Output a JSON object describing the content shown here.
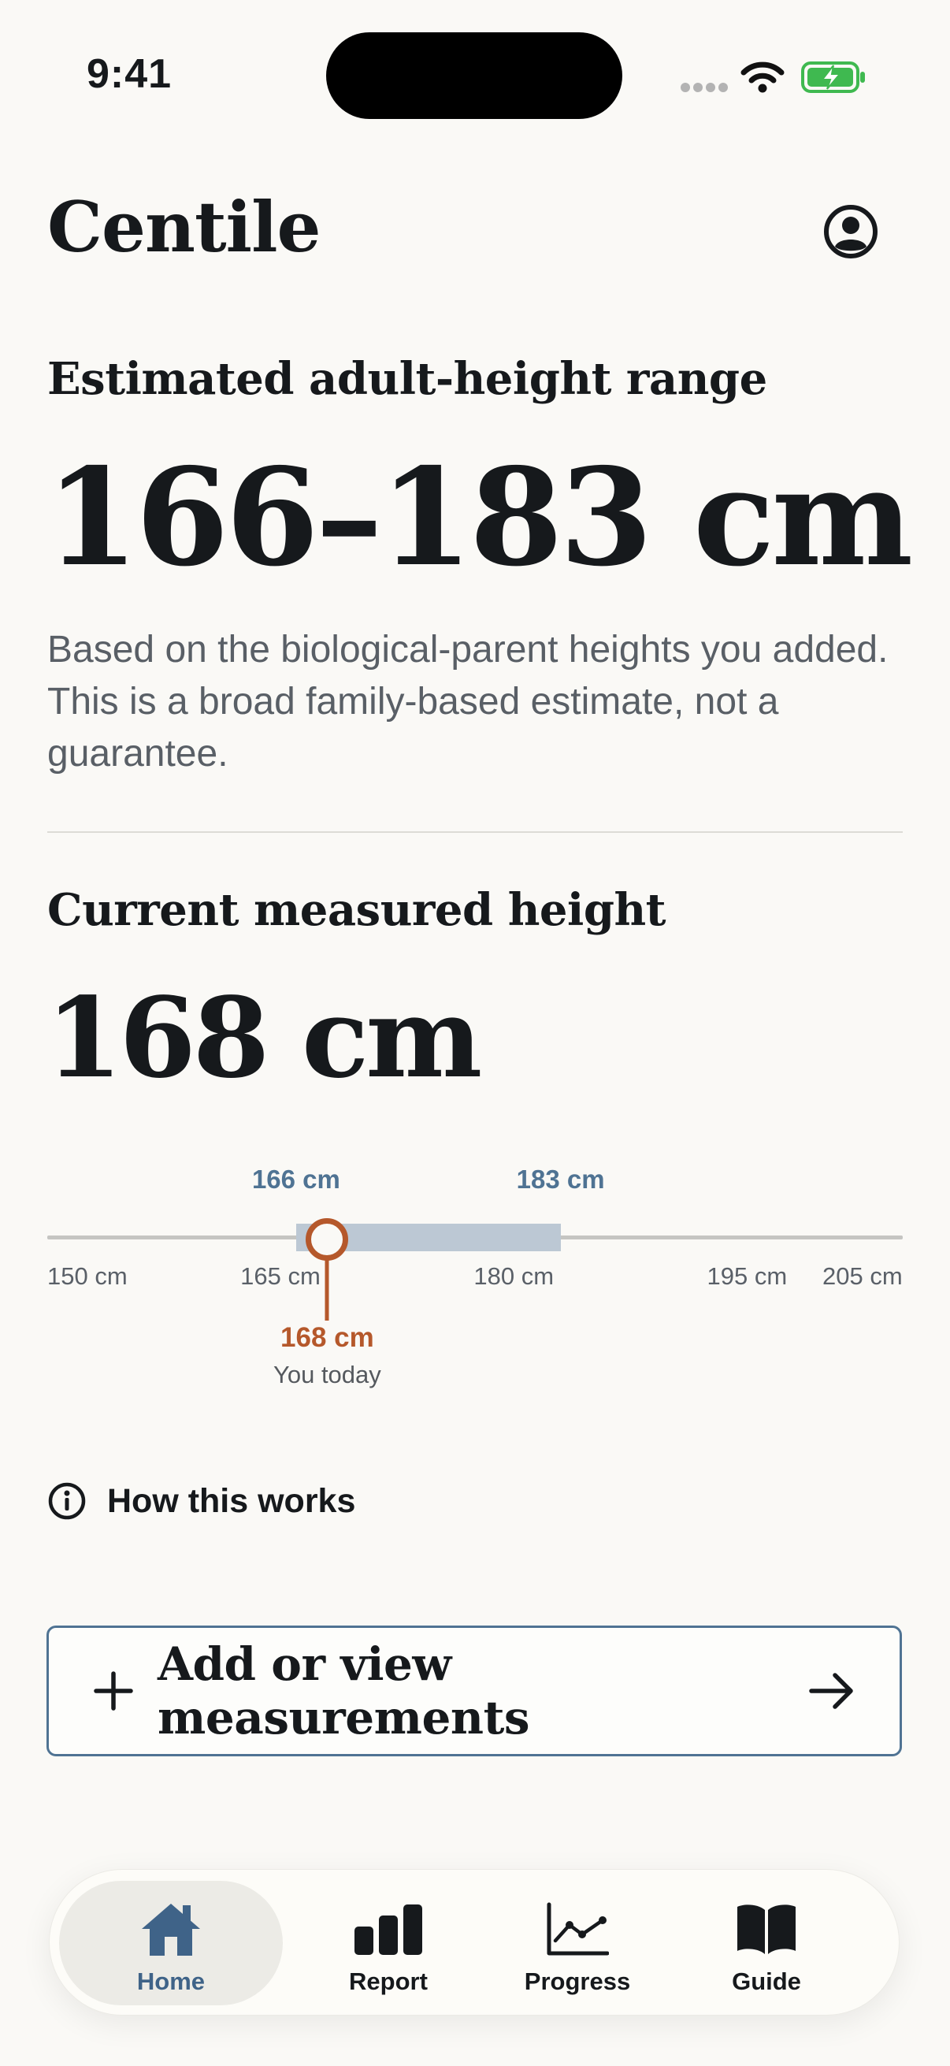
{
  "status_bar": {
    "time": "9:41"
  },
  "header": {
    "title": "Centile",
    "profile_icon": "person-circle-icon"
  },
  "range_section": {
    "heading": "Estimated adult-height range",
    "value": "166–183 cm",
    "description": "Based on the biological-parent heights you added. This is a broad family-based estimate, not a guarantee."
  },
  "current_section": {
    "heading": "Current measured height",
    "value": "168 cm"
  },
  "range_chart": {
    "scale_min_cm": 150,
    "scale_max_cm": 205,
    "range_low_cm": 166,
    "range_high_cm": 183,
    "current_cm": 168,
    "range_low_label": "166 cm",
    "range_high_label": "183 cm",
    "ticks": [
      {
        "value": 150,
        "label": "150 cm"
      },
      {
        "value": 165,
        "label": "165 cm"
      },
      {
        "value": 180,
        "label": "180 cm"
      },
      {
        "value": 195,
        "label": "195 cm"
      },
      {
        "value": 205,
        "label": "205 cm"
      }
    ],
    "current_label": "168 cm",
    "current_caption": "You today",
    "colors": {
      "range": "#bcc8d4",
      "range_label": "#4f7393",
      "marker": "#b5582b"
    }
  },
  "info_link": {
    "label": "How this works",
    "icon": "info-circle-icon"
  },
  "primary_action": {
    "label": "Add or view measurements",
    "leading_icon": "plus-icon",
    "trailing_icon": "arrow-right-icon"
  },
  "tab_bar": {
    "tabs": [
      {
        "label": "Home",
        "icon": "house-icon",
        "active": true
      },
      {
        "label": "Report",
        "icon": "bar-chart-icon",
        "active": false
      },
      {
        "label": "Progress",
        "icon": "line-chart-icon",
        "active": false
      },
      {
        "label": "Guide",
        "icon": "book-icon",
        "active": false
      }
    ]
  },
  "theme": {
    "accent": "#3f6388",
    "background": "#faf9f6",
    "text": "#16191c"
  }
}
